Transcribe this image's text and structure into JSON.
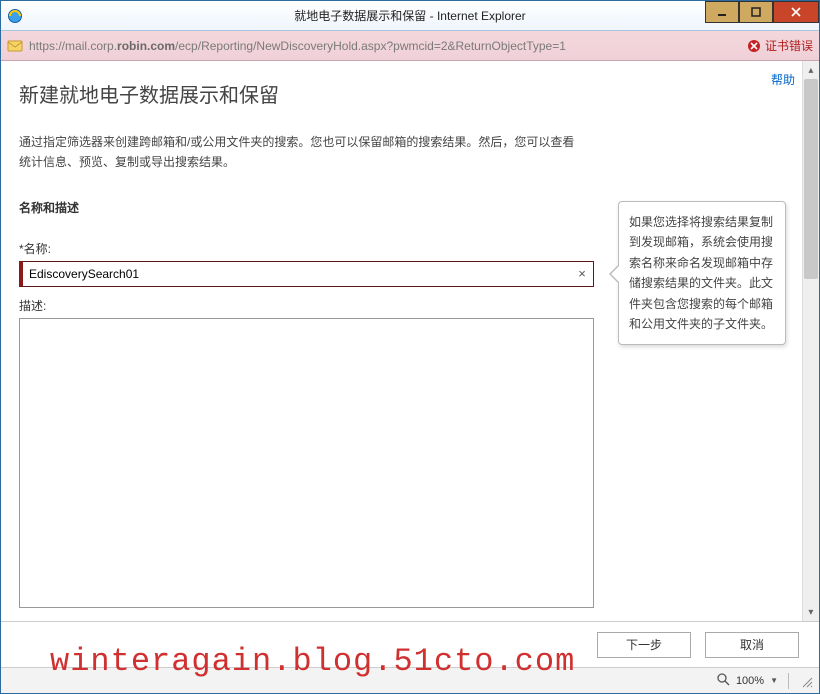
{
  "window": {
    "title": "就地电子数据展示和保留 - Internet Explorer"
  },
  "address": {
    "url_pre": "https://mail.corp.",
    "url_bold": "robin.com",
    "url_post": "/ecp/Reporting/NewDiscoveryHold.aspx?pwmcid=2&ReturnObjectType=1",
    "cert_error": "证书错误"
  },
  "page": {
    "help": "帮助",
    "title": "新建就地电子数据展示和保留",
    "intro": "通过指定筛选器来创建跨邮箱和/或公用文件夹的搜索。您也可以保留邮箱的搜索结果。然后，您可以查看统计信息、预览、复制或导出搜索结果。",
    "section": "名称和描述",
    "name_label": "*名称:",
    "name_value": "EdiscoverySearch01",
    "clear_glyph": "×",
    "desc_label": "描述:",
    "desc_value": ""
  },
  "callout": {
    "text": "如果您选择将搜索结果复制到发现邮箱，系统会使用搜索名称来命名发现邮箱中存储搜索结果的文件夹。此文件夹包含您搜索的每个邮箱和公用文件夹的子文件夹。"
  },
  "footer": {
    "next": "下一步",
    "cancel": "取消"
  },
  "status": {
    "zoom": "100%"
  },
  "watermark": "winteragain.blog.51cto.com"
}
